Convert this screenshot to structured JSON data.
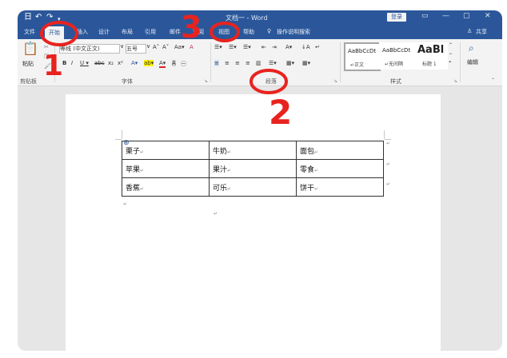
{
  "titlebar": {
    "quick_access": [
      "日",
      "↶",
      "↷",
      "▾"
    ],
    "doc_title": "文档一 - Word",
    "login": "登录",
    "window_controls": [
      "▭",
      "—",
      "▢",
      "✕"
    ]
  },
  "tabs": [
    "文件",
    "开始",
    "插入",
    "设计",
    "布局",
    "引用",
    "邮件",
    "审阅",
    "视图",
    "帮助",
    "操作说明搜索"
  ],
  "share": "共享",
  "ribbon": {
    "clipboard": {
      "paste": "粘贴",
      "group": "剪贴板"
    },
    "font": {
      "name": "等线 (中文正文)",
      "size": "五号",
      "row1_buttons": [
        "A˄",
        "A˅",
        "Aa▾",
        "A"
      ],
      "row2_buttons": [
        "B",
        "I",
        "U ▾",
        "abc",
        "x₂",
        "x²",
        "A▾",
        "ab▾",
        "A▾",
        "A",
        "㊀"
      ],
      "group": "字体"
    },
    "paragraph": {
      "row1": [
        "☰▾",
        "☰▾",
        "☰▾",
        "⇤",
        "⇥",
        "A▾",
        "↓A",
        "↵"
      ],
      "row2": [
        "≡",
        "≡",
        "≡",
        "≡",
        "▥",
        "☰▾",
        "▦▾",
        "▦▾"
      ],
      "group": "段落"
    },
    "styles": {
      "items": [
        {
          "sample": "AaBbCcDt",
          "label": "↵正文"
        },
        {
          "sample": "AaBbCcDt",
          "label": "↵无间隔"
        },
        {
          "sample": "AaBl",
          "label": "标题 1"
        }
      ],
      "group": "样式"
    },
    "editing": {
      "label": "编辑"
    }
  },
  "table": [
    [
      "栗子",
      "牛奶",
      "面包"
    ],
    [
      "苹果",
      "果汁",
      "零食"
    ],
    [
      "香蕉",
      "可乐",
      "饼干"
    ]
  ],
  "paragraph_mark": "↵",
  "annotations": [
    "1",
    "2",
    "3"
  ],
  "colors": {
    "accent": "#2b579a",
    "annotation": "#e8231f"
  }
}
